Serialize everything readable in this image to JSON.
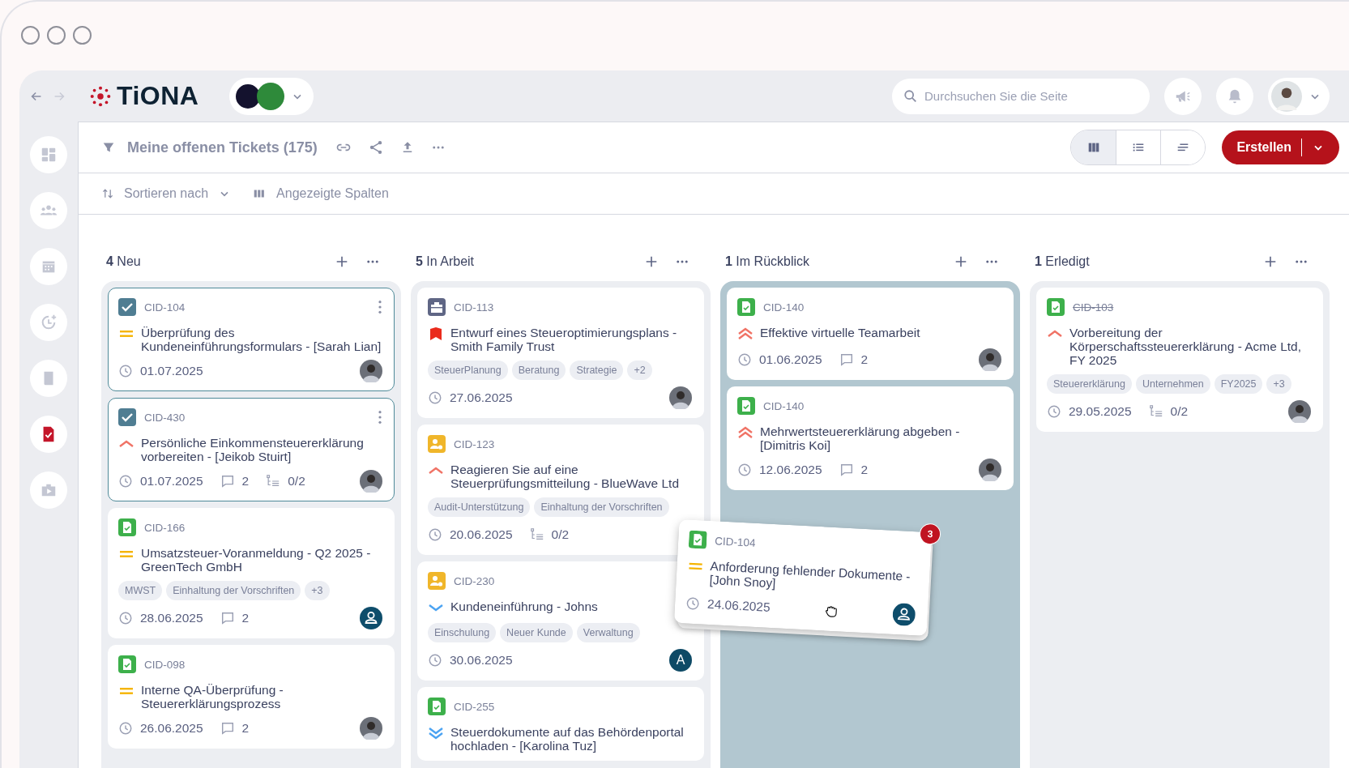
{
  "nav": {
    "back": {
      "disabled": false
    },
    "forward": {
      "disabled": true
    }
  },
  "logo": {
    "text": "TiONA"
  },
  "search": {
    "placeholder": "Durchsuchen Sie die Seite"
  },
  "sidebar": {
    "items": [
      {
        "kind": "dashboard",
        "selected": false
      },
      {
        "kind": "people",
        "selected": false
      },
      {
        "kind": "calendar",
        "selected": false
      },
      {
        "kind": "clock",
        "selected": false
      },
      {
        "kind": "book",
        "selected": false
      },
      {
        "kind": "document",
        "selected": true
      },
      {
        "kind": "case",
        "selected": false
      }
    ]
  },
  "toolbar": {
    "title": "Meine offenen Tickets (175)",
    "views": [
      {
        "kind": "board",
        "selected": true
      },
      {
        "kind": "list",
        "selected": false
      },
      {
        "kind": "timeline",
        "selected": false
      }
    ],
    "create_button": "Erstellen"
  },
  "filters": {
    "sort": "Sortieren nach",
    "columns": "Angezeigte Spalten"
  },
  "columns": [
    {
      "count": "4",
      "name": "Neu",
      "drop_target": false,
      "cards": [
        {
          "id": "CID-104",
          "priority": {
            "kind": "medium"
          },
          "title": "Überprüfung des Kundeneinführungsformulars - [Sarah Lian]",
          "due": "01.07.2025",
          "assignee": {
            "kind": "photo"
          },
          "selected": true,
          "done": false
        },
        {
          "id": "CID-430",
          "priority": {
            "kind": "high"
          },
          "title": "Persönliche Einkommensteuererklärung vorbereiten - [Jeikob Stuirt]",
          "due": "01.07.2025",
          "comments": "2",
          "subtasks": "0/2",
          "assignee": {
            "kind": "photo"
          },
          "selected": true,
          "done": false
        },
        {
          "id": "CID-166",
          "kind": "document",
          "priority": {
            "kind": "medium"
          },
          "title": "Umsatzsteuer-Voranmeldung - Q2 2025 - GreenTech GmbH",
          "tags": [
            "MWST",
            "Einhaltung der Vorschriften",
            "+3"
          ],
          "due": "28.06.2025",
          "comments": "2",
          "assignee": {
            "kind": "placeholder"
          },
          "selected": false,
          "done": false
        },
        {
          "id": "CID-098",
          "kind": "document",
          "priority": {
            "kind": "medium"
          },
          "title": "Interne QA-Überprüfung - Steuererklärungsprozess",
          "due": "26.06.2025",
          "comments": "2",
          "assignee": {
            "kind": "photo"
          },
          "selected": false,
          "done": false
        }
      ]
    },
    {
      "count": "5",
      "name": "In Arbeit",
      "drop_target": false,
      "cards": [
        {
          "id": "CID-113",
          "kind": "briefcase",
          "priority": {
            "kind": "critical"
          },
          "title": "Entwurf eines Steueroptimierungsplans - Smith Family Trust",
          "tags": [
            "SteuerPlanung",
            "Beratung",
            "Strategie",
            "+2"
          ],
          "due": "27.06.2025",
          "assignee": {
            "kind": "photo"
          },
          "selected": false,
          "done": false
        },
        {
          "id": "CID-123",
          "kind": "person",
          "priority": {
            "kind": "high"
          },
          "title": "Reagieren Sie auf eine Steuerprüfungsmitteilung - BlueWave Ltd",
          "tags": [
            "Audit-Unterstützung",
            "Einhaltung der Vorschriften"
          ],
          "due": "20.06.2025",
          "subtasks": "0/2",
          "selected": false,
          "done": false
        },
        {
          "id": "CID-230",
          "kind": "person",
          "priority": {
            "kind": "low"
          },
          "title": "Kundeneinführung - Johns",
          "tags": [
            "Einschulung",
            "Neuer Kunde",
            "Verwaltung"
          ],
          "due": "30.06.2025",
          "assignee": {
            "kind": "initial",
            "text": "A"
          },
          "selected": false,
          "done": false
        },
        {
          "id": "CID-255",
          "kind": "document",
          "priority": {
            "kind": "lowest"
          },
          "title": "Steuerdokumente auf das Behördenportal hochladen - [Karolina Tuz]",
          "selected": false,
          "done": false
        }
      ]
    },
    {
      "count": "1",
      "name": "Im Rückblick",
      "drop_target": true,
      "cards": [
        {
          "id": "CID-140",
          "kind": "document",
          "priority": {
            "kind": "highest"
          },
          "title": "Effektive virtuelle Teamarbeit",
          "due": "01.06.2025",
          "comments": "2",
          "assignee": {
            "kind": "photo"
          },
          "selected": false,
          "done": false
        },
        {
          "id": "CID-140",
          "kind": "document",
          "priority": {
            "kind": "highest"
          },
          "title": "Mehrwertsteuererklärung abgeben - [Dimitris Koi]",
          "due": "12.06.2025",
          "comments": "2",
          "assignee": {
            "kind": "photo"
          },
          "selected": false,
          "done": false
        }
      ]
    },
    {
      "count": "1",
      "name": "Erledigt",
      "drop_target": false,
      "cards": [
        {
          "id": "CID-103",
          "kind": "document",
          "priority": {
            "kind": "high"
          },
          "title": "Vorbereitung der Körperschaftssteuererklärung - Acme Ltd, FY 2025",
          "tags": [
            "Steuererklärung",
            "Unternehmen",
            "FY2025",
            "+3"
          ],
          "due": "29.05.2025",
          "subtasks": "0/2",
          "assignee": {
            "kind": "photo"
          },
          "selected": false,
          "done": true
        }
      ]
    }
  ],
  "dragged_card": {
    "id": "CID-104",
    "kind": "document",
    "priority": {
      "kind": "medium"
    },
    "title": "Anforderung fehlender Dokumente - [John Snoy]",
    "due": "24.06.2025",
    "assignee": {
      "kind": "placeholder"
    },
    "badge": "3"
  }
}
